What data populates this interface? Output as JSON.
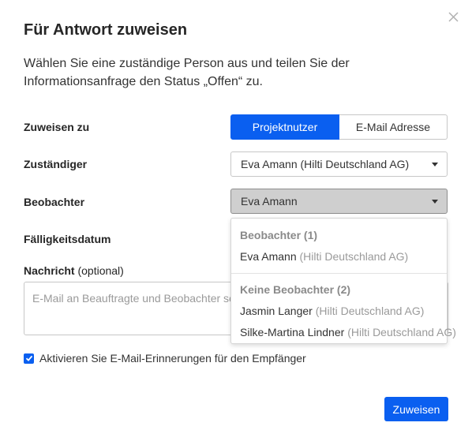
{
  "dialog": {
    "title": "Für Antwort zuweisen",
    "intro": "Wählen Sie eine zuständige Person aus und teilen Sie der Informationsanfrage den Status „Offen“ zu.",
    "close_icon": "close-icon"
  },
  "assign_to": {
    "label": "Zuweisen zu",
    "options": [
      "Projektnutzer",
      "E-Mail Adresse"
    ],
    "selected": "Projektnutzer"
  },
  "responsible": {
    "label": "Zuständiger",
    "value": "Eva Amann (Hilti Deutschland AG)"
  },
  "observer": {
    "label": "Beobachter",
    "value": "Eva Amann"
  },
  "due_date": {
    "label": "Fälligkeitsdatum"
  },
  "message": {
    "label": "Nachricht",
    "label_optional": "(optional)",
    "placeholder": "E-Mail an Beauftragte und Beobachter senden"
  },
  "reminder": {
    "checked": true,
    "label": "Aktivieren Sie E-Mail-Erinnerungen für den Empfänger"
  },
  "submit_label": "Zuweisen",
  "observer_dropdown": {
    "groups": [
      {
        "title": "Beobachter (1)",
        "items": [
          {
            "name": "Eva Amann",
            "company": "(Hilti Deutschland AG)"
          }
        ]
      },
      {
        "title": "Keine Beobachter (2)",
        "items": [
          {
            "name": "Jasmin Langer",
            "company": "(Hilti Deutschland AG)"
          },
          {
            "name": "Silke-Martina Lindner",
            "company": "(Hilti Deutschland AG)"
          }
        ]
      }
    ]
  },
  "colors": {
    "accent": "#0a5ff0",
    "muted_text": "#9a9a9a"
  }
}
